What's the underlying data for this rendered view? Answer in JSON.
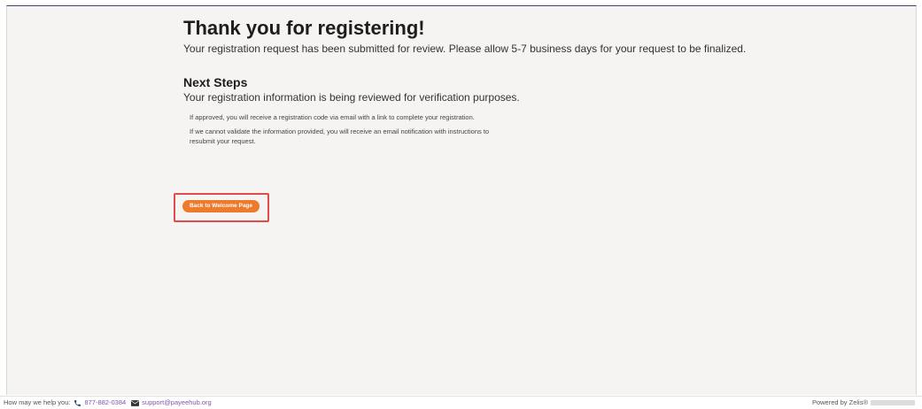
{
  "main": {
    "title": "Thank you for registering!",
    "subtitle": "Your registration request has been submitted for review. Please allow 5-7 business days for your request to be finalized.",
    "next_steps": {
      "heading": "Next Steps",
      "text": "Your registration information is being reviewed for verification purposes.",
      "notes": [
        "If approved, you will receive a registration code via email with a link to complete your registration.",
        "If we cannot validate the information provided, you will receive an email notification with instructions to resubmit your request."
      ]
    },
    "back_button_label": "Back to Welcome Page"
  },
  "footer": {
    "help_text": "How may we help you:",
    "phone_icon": "phone-icon",
    "phone": "877-882-0384",
    "email_icon": "envelope-icon",
    "email": "support@payeehub.org",
    "powered_by": "Powered by Zelis®"
  },
  "colors": {
    "accent": "#ee7a2c",
    "link": "#7b5aa6",
    "highlight": "#e04b4b",
    "background": "#f5f4f2"
  }
}
